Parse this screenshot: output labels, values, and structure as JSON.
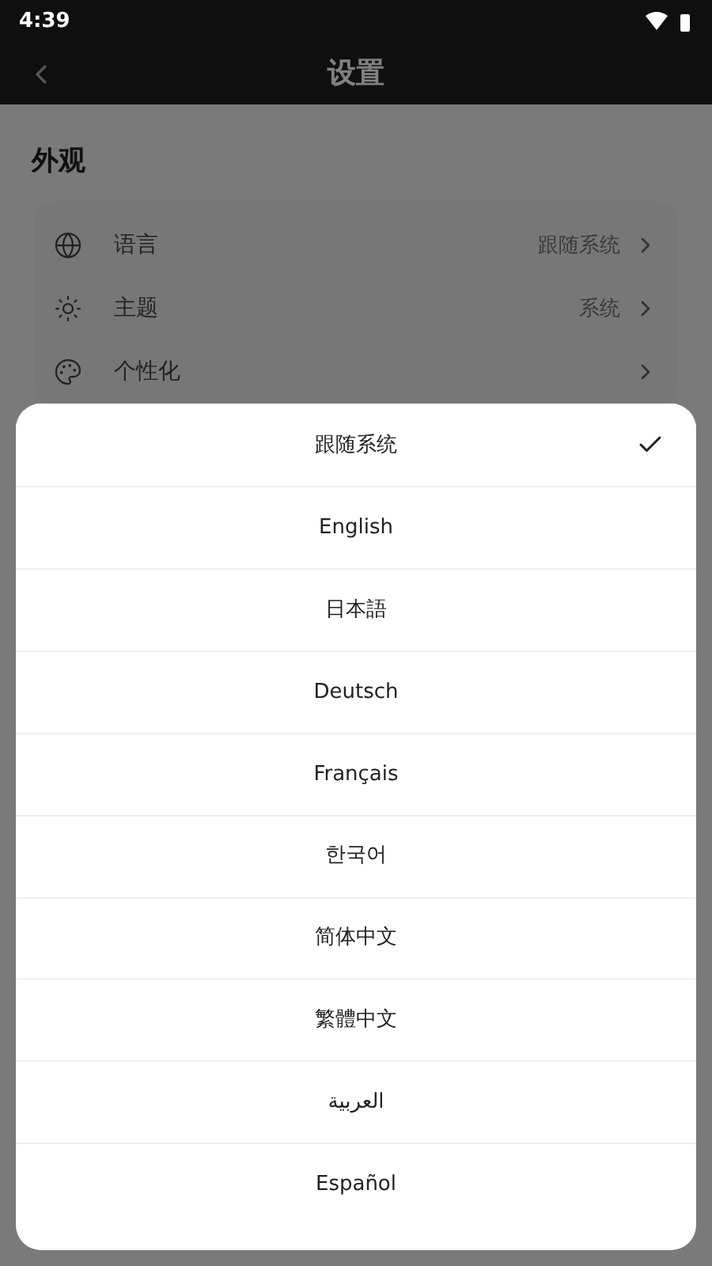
{
  "status_bar": {
    "time": "4:39"
  },
  "header": {
    "title": "设置"
  },
  "section": {
    "title": "外观"
  },
  "settings": [
    {
      "kind": "language",
      "label": "语言",
      "value": "跟随系统"
    },
    {
      "kind": "theme",
      "label": "主题",
      "value": "系统"
    },
    {
      "kind": "personalize",
      "label": "个性化"
    }
  ],
  "language_sheet": {
    "options": [
      {
        "label": "跟随系统",
        "selected": true
      },
      {
        "label": "English",
        "selected": false
      },
      {
        "label": "日本語",
        "selected": false
      },
      {
        "label": "Deutsch",
        "selected": false
      },
      {
        "label": "Français",
        "selected": false
      },
      {
        "label": "한국어",
        "selected": false
      },
      {
        "label": "简体中文",
        "selected": false
      },
      {
        "label": "繁體中文",
        "selected": false
      },
      {
        "label": "العربية",
        "selected": false
      },
      {
        "label": "Español",
        "selected": false
      }
    ]
  }
}
